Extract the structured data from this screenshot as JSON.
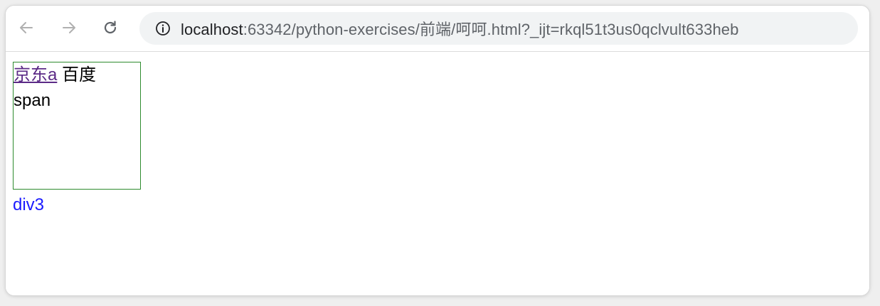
{
  "browser": {
    "url_host": "localhost",
    "url_rest": ":63342/python-exercises/前端/呵呵.html?_ijt=rkql51t3us0qclvult633heb",
    "icons": {
      "back": "arrow-left-icon",
      "forward": "arrow-right-icon",
      "reload": "reload-icon",
      "site_info": "info-icon"
    }
  },
  "page": {
    "link_text": "京东a",
    "inline_text": "百度",
    "span_text": "span",
    "div3_text": "div3"
  },
  "colors": {
    "box_border": "#2e8b2e",
    "link": "#5b2a86",
    "div3": "#1a1aff"
  }
}
